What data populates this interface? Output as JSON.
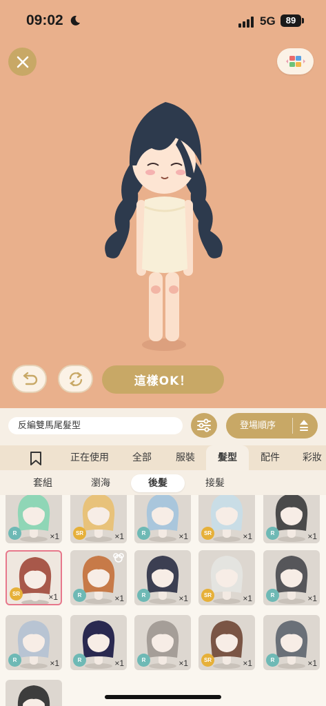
{
  "status_bar": {
    "time": "09:02",
    "network": "5G",
    "battery": "89"
  },
  "avatar_editor": {
    "confirm_label": "這樣OK！"
  },
  "item_name": "反編雙馬尾髮型",
  "sort": {
    "label": "登場順序"
  },
  "tabs": [
    "正在使用",
    "全部",
    "服裝",
    "髮型",
    "配件",
    "彩妝"
  ],
  "active_tab": "髮型",
  "subtabs": [
    "套組",
    "瀏海",
    "後髮",
    "接髮"
  ],
  "active_subtab": "後髮",
  "items": [
    {
      "rarity": "R",
      "count": "×1",
      "hair": "#8fd6b6"
    },
    {
      "rarity": "SR",
      "count": "×1",
      "hair": "#e8c27a"
    },
    {
      "rarity": "R",
      "count": "×1",
      "hair": "#a9c6dc"
    },
    {
      "rarity": "SR",
      "count": "×1",
      "hair": "#c9dde6"
    },
    {
      "rarity": "R",
      "count": "×1",
      "hair": "#4a4a4a"
    },
    {
      "rarity": "SR",
      "count": "×1",
      "hair": "#a8584a",
      "selected": true
    },
    {
      "rarity": "R",
      "count": "×1",
      "hair": "#c77a48",
      "new": true
    },
    {
      "rarity": "R",
      "count": "×1",
      "hair": "#3c3f52"
    },
    {
      "rarity": "SR",
      "count": "×1",
      "hair": "#e4e4e0"
    },
    {
      "rarity": "R",
      "count": "×1",
      "hair": "#56565a"
    },
    {
      "rarity": "R",
      "count": "×1",
      "hair": "#b8c4d3"
    },
    {
      "rarity": "R",
      "count": "×1",
      "hair": "#2a2950"
    },
    {
      "rarity": "R",
      "count": "×1",
      "hair": "#a59e98"
    },
    {
      "rarity": "SR",
      "count": "×1",
      "hair": "#7a5545"
    },
    {
      "rarity": "R",
      "count": "×1",
      "hair": "#6a7078"
    },
    {
      "rarity": "",
      "count": "",
      "hair": "#3d3d3d"
    }
  ]
}
